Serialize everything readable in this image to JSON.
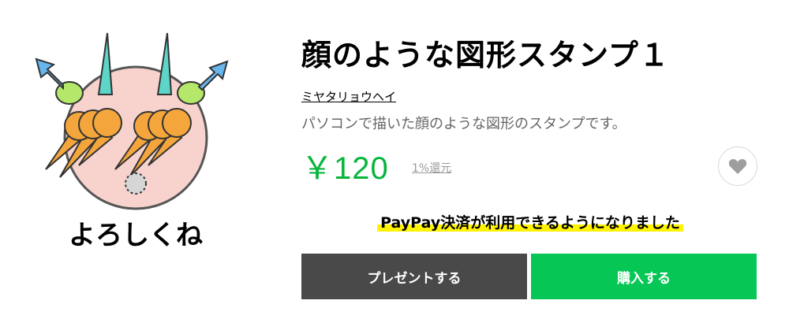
{
  "product": {
    "title": "顔のような図形スタンプ１",
    "author": "ミヤタリョウヘイ",
    "description": "パソコンで描いた顔のような図形のスタンプです。",
    "price": "￥120",
    "reward": "1%還元",
    "hero_caption": "よろしくね"
  },
  "notice": {
    "text": "PayPay決済が利用できるようになりました"
  },
  "buttons": {
    "gift_label": "プレゼントする",
    "buy_label": "購入する"
  },
  "icons": {
    "favorite": "heart-icon"
  },
  "colors": {
    "price_green": "#07b53b",
    "buy_button": "#06c755",
    "gift_button": "#494949",
    "highlight": "#fff300",
    "face_fill": "#f8d3ce"
  }
}
